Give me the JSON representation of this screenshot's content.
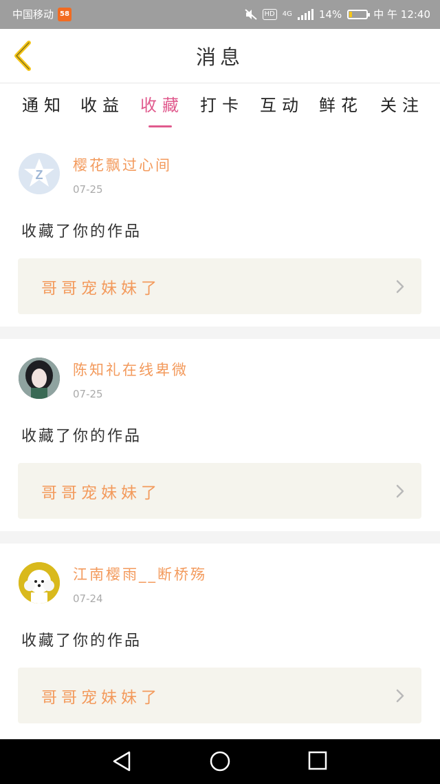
{
  "status_bar": {
    "carrier": "中国移动",
    "app_badge": "58",
    "hd": "HD",
    "network": "4G",
    "battery_percent": "14%",
    "time": "中 午 12:40",
    "battery_level": 0.14,
    "battery_color": "#f5c518"
  },
  "header": {
    "title": "消息",
    "back_icon": "chevron-left-icon",
    "back_color": "#f5c518"
  },
  "tabs": [
    {
      "label": "通知",
      "active": false
    },
    {
      "label": "收益",
      "active": false
    },
    {
      "label": "收藏",
      "active": true
    },
    {
      "label": "打卡",
      "active": false
    },
    {
      "label": "互动",
      "active": false
    },
    {
      "label": "鲜花",
      "active": false
    },
    {
      "label": "关注",
      "active": false
    }
  ],
  "accent_color": "#e05a8d",
  "name_color": "#f39a5c",
  "messages": [
    {
      "user": "樱花飘过心间",
      "date": "07-25",
      "action": "收藏了你的作品",
      "work_title": "哥哥宠妹妹了",
      "avatar": "default-avatar-icon"
    },
    {
      "user": "陈知礼在线卑微",
      "date": "07-25",
      "action": "收藏了你的作品",
      "work_title": "哥哥宠妹妹了",
      "avatar": "user-photo-girl"
    },
    {
      "user": "江南樱雨__断桥殇",
      "date": "07-24",
      "action": "收藏了你的作品",
      "work_title": "哥哥宠妹妹了",
      "avatar": "user-photo-dog"
    }
  ],
  "system_nav": {
    "back": "nav-back-icon",
    "home": "nav-home-icon",
    "recents": "nav-recents-icon"
  }
}
